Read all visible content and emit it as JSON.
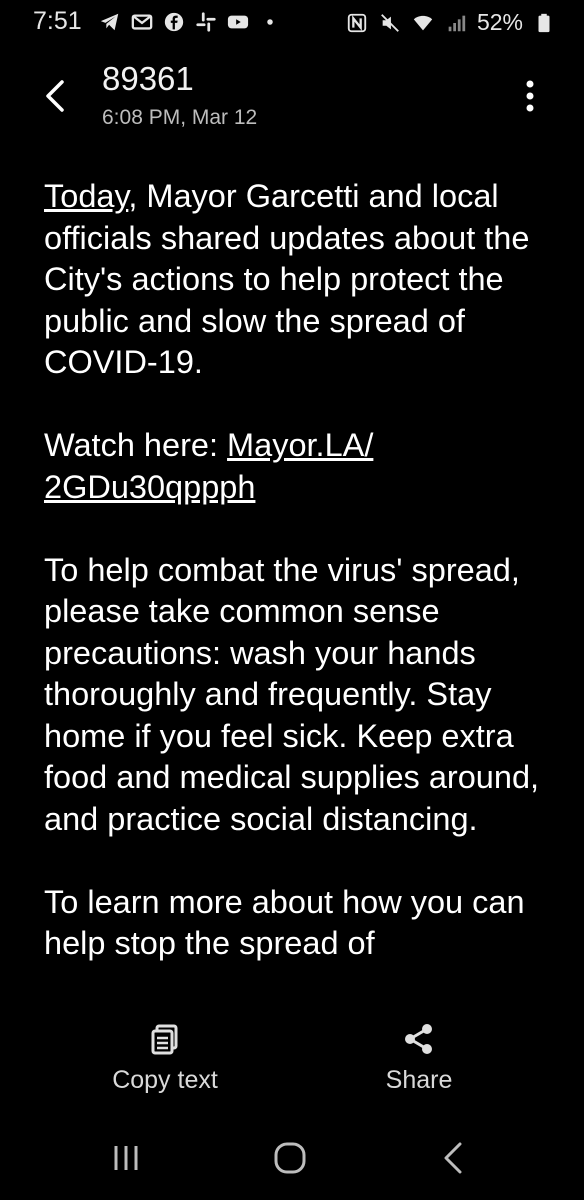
{
  "status_bar": {
    "time": "7:51",
    "battery": "52%",
    "left_icons": [
      "telegram-icon",
      "gmail-icon",
      "facebook-icon",
      "slack-icon",
      "youtube-icon",
      "dot-icon"
    ],
    "right_icons": [
      "nfc-icon",
      "mute-icon",
      "wifi-icon",
      "signal-icon",
      "battery-icon"
    ]
  },
  "header": {
    "title": "89361",
    "subtitle": "6:08 PM, Mar 12"
  },
  "message": {
    "p1_link": "Today",
    "p1_rest": ", Mayor Garcetti and local officials shared updates about the City's actions to help protect the public and slow the spread of COVID-19.",
    "p2_prefix": "Watch here: ",
    "p2_link": "Mayor.LA/ 2GDu30qppph",
    "p3": "To help combat the virus' spread, please take common sense precautions: wash your hands thoroughly and frequently. Stay home if you feel sick. Keep extra food and medical supplies around, and practice social distancing.",
    "p4": "To learn more about how you can help stop the spread of"
  },
  "actions": {
    "copy_label": "Copy text",
    "share_label": "Share"
  },
  "colors": {
    "background": "#000000",
    "text": "#ffffff",
    "secondary": "#bdbdbd"
  }
}
